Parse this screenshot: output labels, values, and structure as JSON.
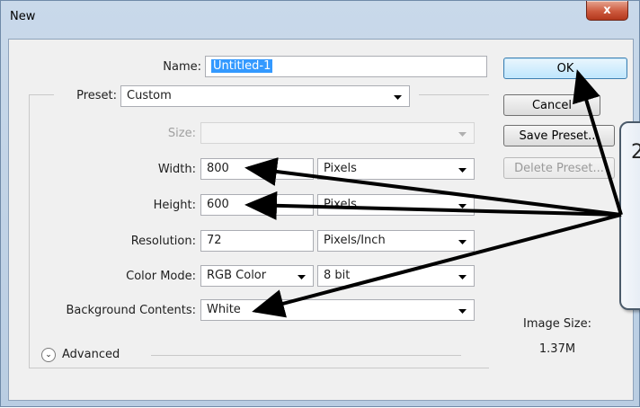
{
  "window": {
    "title": "New",
    "close_label": "x"
  },
  "form": {
    "name": {
      "label": "Name:",
      "value": "Untitled-1"
    },
    "preset": {
      "label": "Preset:",
      "value": "Custom"
    },
    "size": {
      "label": "Size:",
      "value": ""
    },
    "width": {
      "label": "Width:",
      "value": "800",
      "unit": "Pixels"
    },
    "height": {
      "label": "Height:",
      "value": "600",
      "unit": "Pixels"
    },
    "resolution": {
      "label": "Resolution:",
      "value": "72",
      "unit": "Pixels/Inch"
    },
    "color_mode": {
      "label": "Color Mode:",
      "value": "RGB Color",
      "depth": "8 bit"
    },
    "background": {
      "label": "Background Contents:",
      "value": "White"
    },
    "advanced": {
      "label": "Advanced"
    }
  },
  "buttons": {
    "ok": "OK",
    "cancel": "Cancel",
    "save_preset": "Save Preset...",
    "delete_preset": "Delete Preset..."
  },
  "image_size": {
    "label": "Image Size:",
    "value": "1.37M"
  },
  "callout": {
    "number": "2"
  }
}
